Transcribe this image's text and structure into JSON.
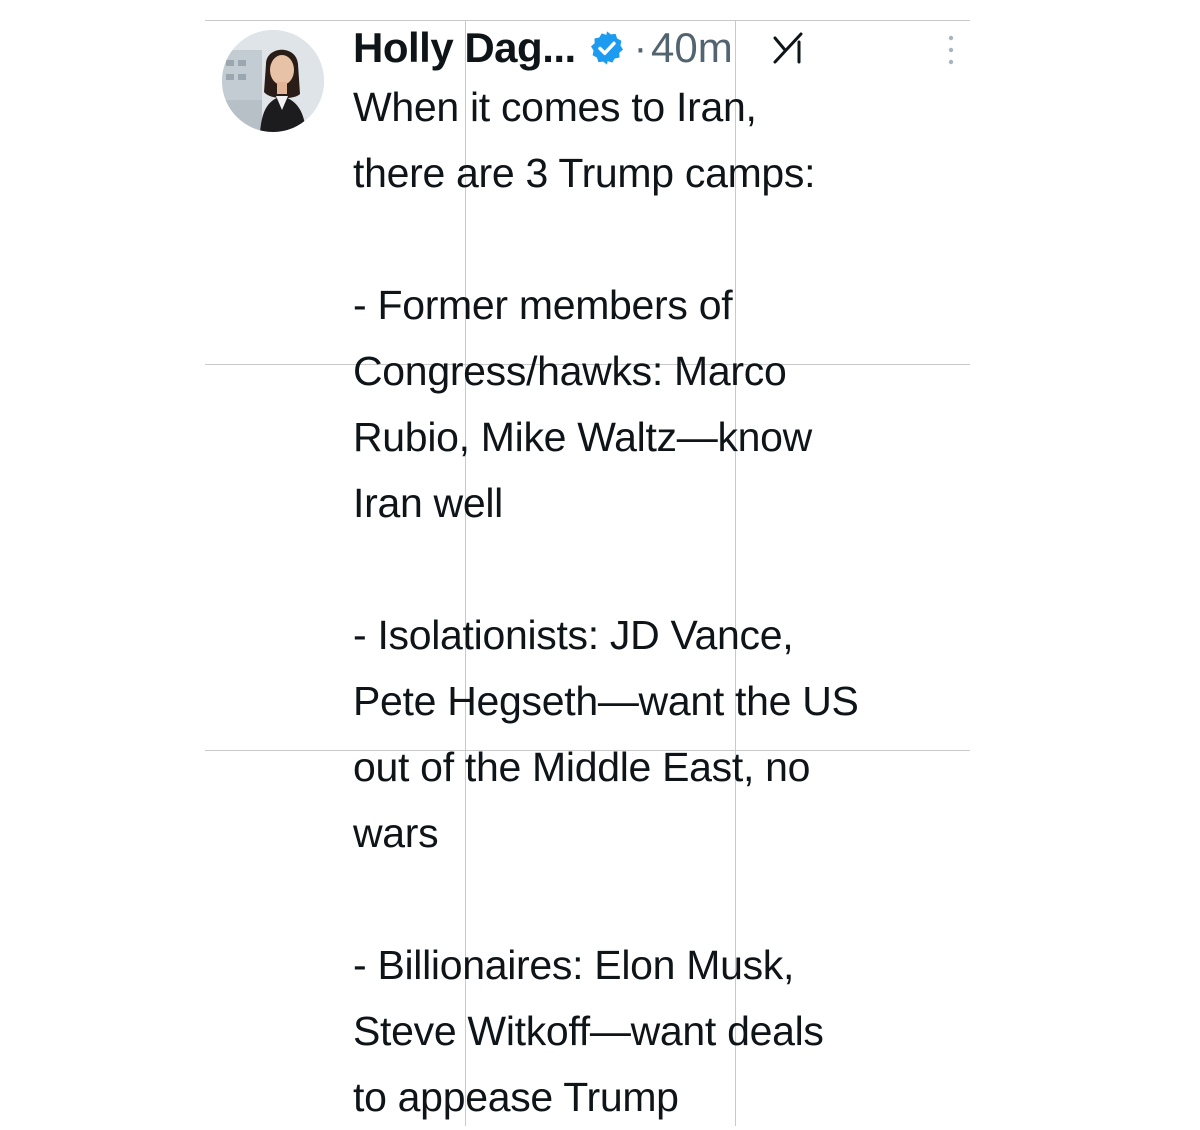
{
  "tweet": {
    "author_name": "Holly Dag...",
    "separator": "·",
    "timestamp": "40m",
    "icons": {
      "verified": "verified-badge-icon",
      "grok": "grok-icon",
      "more": "more-options-icon"
    },
    "colors": {
      "verified": "#1d9bf0",
      "text": "#0f1419",
      "muted": "#536471"
    },
    "paragraphs": [
      {
        "lines": [
          "When it comes to Iran,",
          "there are 3 Trump camps:"
        ]
      },
      {
        "lines": [
          "- Former members of",
          "Congress/hawks: Marco",
          "Rubio, Mike Waltz—know",
          "Iran well"
        ]
      },
      {
        "lines": [
          "- Isolationists: JD Vance,",
          "Pete Hegseth—want the US",
          "out of the Middle East, no",
          "wars"
        ]
      },
      {
        "lines": [
          "- Billionaires: Elon Musk,",
          "Steve Witkoff—want deals",
          "to appease Trump"
        ]
      }
    ]
  }
}
